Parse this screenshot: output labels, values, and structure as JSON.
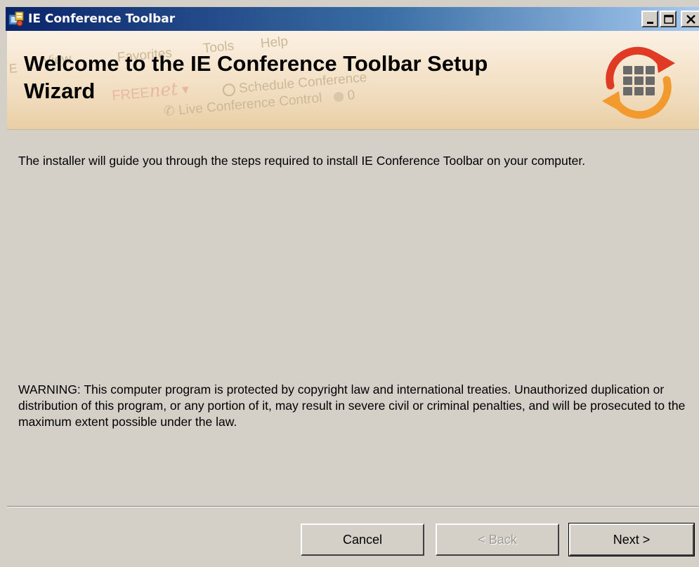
{
  "window": {
    "title": "IE Conference Toolbar",
    "controls": {
      "minimize_icon": "minimize-icon",
      "maximize_icon": "maximize-icon",
      "close_icon": "close-icon"
    }
  },
  "banner": {
    "title": "Welcome to the IE Conference Toolbar Setup Wizard",
    "background_screenshot": {
      "menu_items": [
        "E",
        "View",
        "Favorites",
        "Tools",
        "Help"
      ],
      "brand_free": "FREE",
      "brand_net": "net",
      "schedule_label": "Schedule Conference",
      "live_label": "Live Conference Control",
      "live_count": "0"
    },
    "logo_icon": "conference-toolbar-logo"
  },
  "content": {
    "intro": "The installer will guide you through the steps required to install IE Conference Toolbar on your computer.",
    "warning": "WARNING: This computer program is protected by copyright law and international treaties. Unauthorized duplication or distribution of this program, or any portion of it, may result in severe civil or criminal penalties, and will be prosecuted to the maximum extent possible under the law."
  },
  "buttons": {
    "cancel": "Cancel",
    "back": "< Back",
    "next": "Next >"
  },
  "colors": {
    "titlebar_start": "#0a246a",
    "titlebar_end": "#a6caf0",
    "dialog_face": "#d4d0c8",
    "logo_red": "#e03a24",
    "logo_orange": "#f29a2e"
  }
}
